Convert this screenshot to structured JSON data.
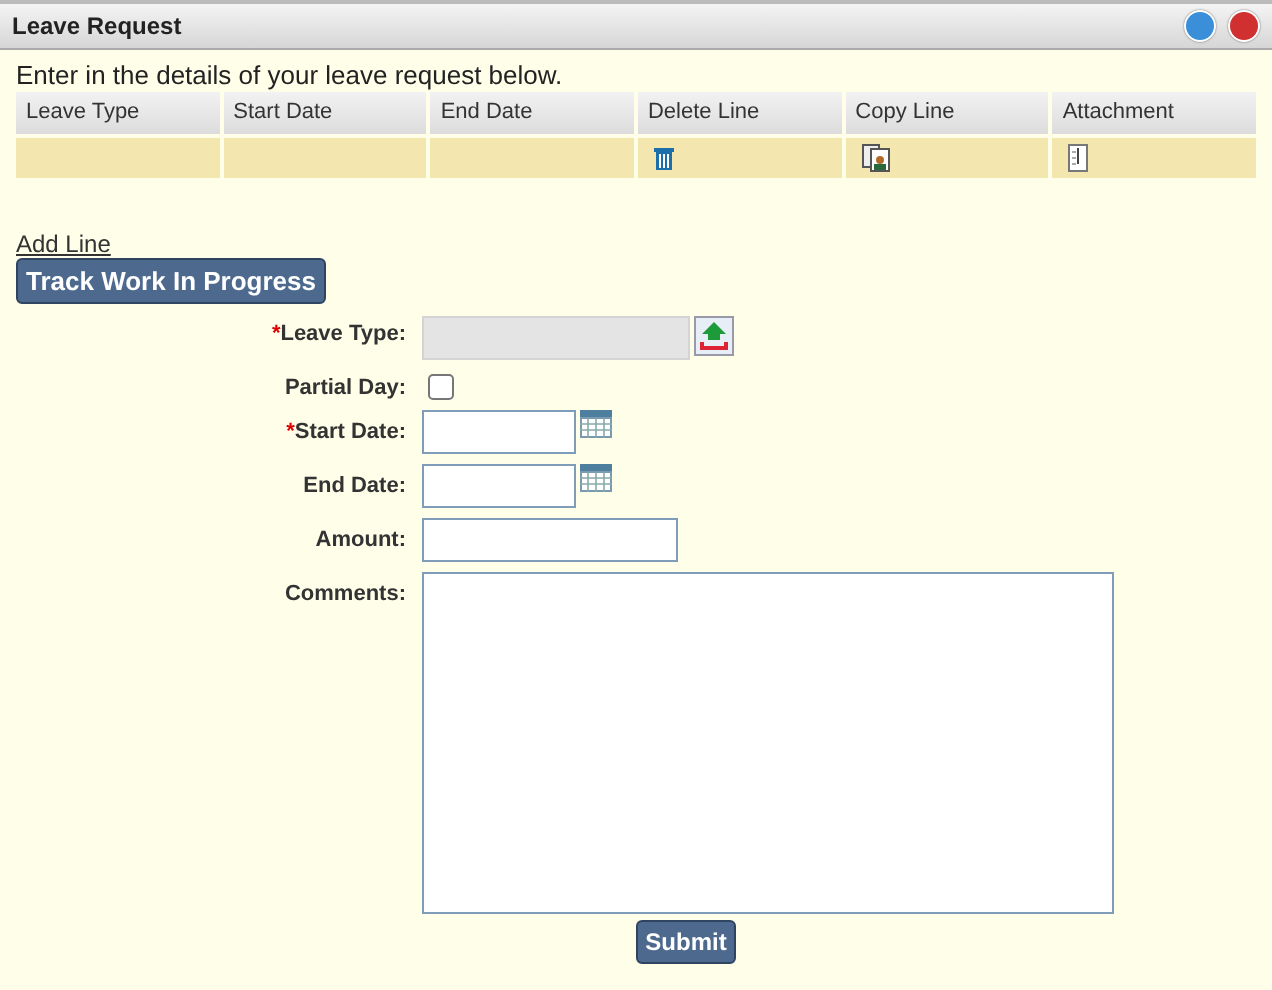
{
  "window": {
    "title": "Leave Request"
  },
  "intro": "Enter in the details of your leave request below.",
  "table": {
    "columns": [
      "Leave Type",
      "Start Date",
      "End Date",
      "Delete Line",
      "Copy Line",
      "Attachment"
    ]
  },
  "add_line": "Add Line",
  "track_button": "Track Work In Progress",
  "fields": [
    {
      "kind": "lookup",
      "label": "Leave Type:",
      "required": true
    },
    {
      "kind": "checkbox",
      "label": "Partial Day:",
      "required": false,
      "checked": false
    },
    {
      "kind": "date",
      "label": "Start Date:",
      "required": true
    },
    {
      "kind": "date",
      "label": "End Date:",
      "required": false
    },
    {
      "kind": "text",
      "label": "Amount:",
      "required": false
    },
    {
      "kind": "textarea",
      "label": "Comments:",
      "required": false
    }
  ],
  "required_mark": "*",
  "submit": "Submit"
}
